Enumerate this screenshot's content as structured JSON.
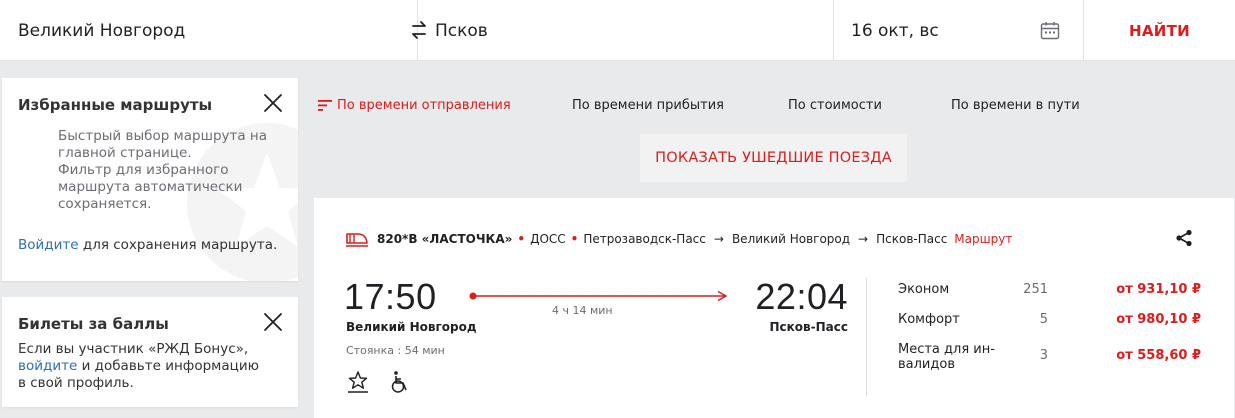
{
  "search": {
    "from": "Великий Новгород",
    "to": "Псков",
    "date": "16 окт, вс",
    "find_label": "НАЙТИ"
  },
  "favorites": {
    "title": "Избранные маршруты",
    "description_1": "Быстрый выбор маршрута на главной странице.",
    "description_2": "Фильтр для избранного маршрута автоматически сохраняется.",
    "login_link": "Войдите",
    "login_suffix": " для сохранения маршрута."
  },
  "bonus": {
    "title": "Билеты за баллы",
    "text_1": "Если вы участник «РЖД Бонус»,",
    "login_link": "войдите",
    "text_2": " и добавьте информацию в свой профиль."
  },
  "sort": {
    "items": [
      {
        "label": "По времени отправления",
        "active": true
      },
      {
        "label": "По времени прибытия",
        "active": false
      },
      {
        "label": "По стоимости",
        "active": false
      },
      {
        "label": "По времени в пути",
        "active": false
      }
    ],
    "show_gone_label": "ПОКАЗАТЬ УШЕДШИЕ ПОЕЗДА"
  },
  "train": {
    "number": "820*В «ЛАСТОЧКА»",
    "carrier": "ДОСС",
    "origin": "Петрозаводск-Пасс",
    "via": "Великий Новгород",
    "destination": "Псков-Пасс",
    "route_link": "Маршрут",
    "route_arrow": "→",
    "departure_time": "17:50",
    "departure_station": "Великий Новгород",
    "arrival_time": "22:04",
    "arrival_station": "Псков-Пасс",
    "duration": "4 ч 14 мин",
    "stop": "Стоянка : 54 мин",
    "features": [
      "priority-passenger-icon",
      "wheelchair-icon"
    ],
    "classes": [
      {
        "name": "Эконом",
        "seats": "251",
        "price": "от 931,10 ₽"
      },
      {
        "name": "Комфорт",
        "seats": "5",
        "price": "от 980,10 ₽"
      },
      {
        "name": "Места для ин-валидов",
        "name_line1": "Места для ин-",
        "name_line2": "валидов",
        "seats": "3",
        "price": "от 558,60 ₽"
      }
    ]
  },
  "colors": {
    "accent": "#e21a1a",
    "link": "#2c6fb3",
    "background": "#e9eaec"
  }
}
